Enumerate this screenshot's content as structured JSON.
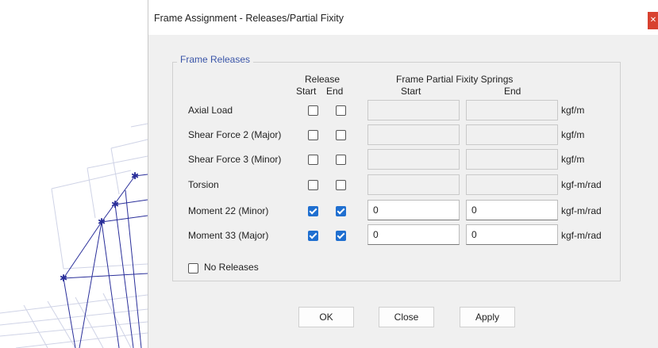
{
  "dialog": {
    "title": "Frame Assignment - Releases/Partial Fixity",
    "close_glyph": "✕"
  },
  "group": {
    "label": "Frame Releases",
    "release_header": "Release",
    "start_header": "Start",
    "end_header": "End",
    "springs_header": "Frame Partial Fixity Springs",
    "springs_start_header": "Start",
    "springs_end_header": "End"
  },
  "rows": [
    {
      "label": "Axial Load",
      "release_start": false,
      "release_end": false,
      "spring_start": "",
      "spring_end": "",
      "unit": "kgf/m",
      "enabled": false
    },
    {
      "label": "Shear Force 2 (Major)",
      "release_start": false,
      "release_end": false,
      "spring_start": "",
      "spring_end": "",
      "unit": "kgf/m",
      "enabled": false
    },
    {
      "label": "Shear Force 3 (Minor)",
      "release_start": false,
      "release_end": false,
      "spring_start": "",
      "spring_end": "",
      "unit": "kgf/m",
      "enabled": false
    },
    {
      "label": "Torsion",
      "release_start": false,
      "release_end": false,
      "spring_start": "",
      "spring_end": "",
      "unit": "kgf-m/rad",
      "enabled": false
    },
    {
      "label": "Moment 22 (Minor)",
      "release_start": true,
      "release_end": true,
      "spring_start": "0",
      "spring_end": "0",
      "unit": "kgf-m/rad",
      "enabled": true
    },
    {
      "label": "Moment 33 (Major)",
      "release_start": true,
      "release_end": true,
      "spring_start": "0",
      "spring_end": "0",
      "unit": "kgf-m/rad",
      "enabled": true
    }
  ],
  "no_releases": {
    "label": "No Releases",
    "checked": false
  },
  "buttons": {
    "ok": "OK",
    "close": "Close",
    "apply": "Apply"
  },
  "colors": {
    "accent": "#1f6fd0",
    "group_label": "#3a55a8",
    "close_button": "#d8412f",
    "model_lines": "#2a2f9a"
  }
}
